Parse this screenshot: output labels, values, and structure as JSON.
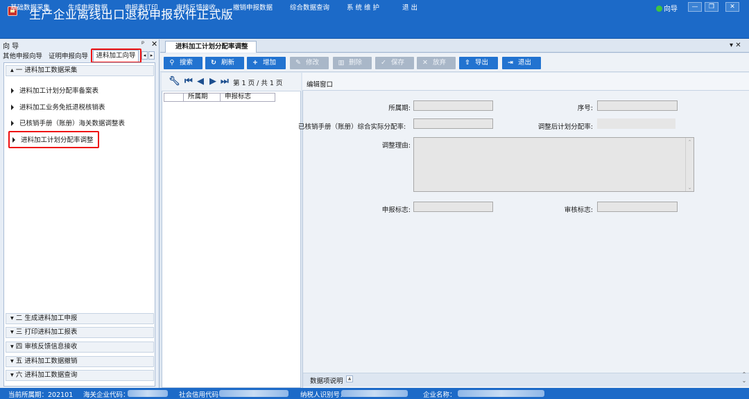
{
  "window": {
    "title": "生产企业离线出口退税申报软件正式版",
    "wizard": "向导"
  },
  "menu": [
    "基础数据采集",
    "生成申报数据",
    "申报表打印",
    "审核反馈接收",
    "撤销申报数据",
    "综合数据查询",
    "系 统 维 护",
    "退 出"
  ],
  "left_panel": {
    "title": "向 导",
    "tabs": [
      "其他申报向导",
      "证明申报向导",
      "进料加工向导"
    ],
    "groups": [
      {
        "label": "一 进料加工数据采集",
        "items": [
          "进料加工计划分配率备案表",
          "进料加工业务免抵退税核销表",
          "已核销手册（账册）海关数据调整表",
          "进料加工计划分配率调整"
        ]
      },
      {
        "label": "二 生成进料加工申报"
      },
      {
        "label": "三 打印进料加工报表"
      },
      {
        "label": "四 审核反馈信息接收"
      },
      {
        "label": "五 进料加工数据撤销"
      },
      {
        "label": "六 进料加工数据查询"
      }
    ]
  },
  "doc_tab": "进料加工计划分配率调整",
  "toolbar": {
    "search": "搜索",
    "refresh": "刷新",
    "add": "增加",
    "edit": "修改",
    "delete": "删除",
    "save": "保存",
    "discard": "放弃",
    "export": "导出",
    "exit": "退出"
  },
  "grid": {
    "pager": "第 1 页 / 共 1 页",
    "columns": [
      "所属期",
      "申报标志"
    ]
  },
  "edit": {
    "title": "编辑窗口",
    "period": "所属期:",
    "seq": "序号:",
    "ratio": "已核销手册（账册）综合实际分配率:",
    "adjusted": "调整后计划分配率:",
    "reason": "调整理由:",
    "declare_flag": "申报标志:",
    "audit_flag": "审核标志:"
  },
  "data_desc": "数据项说明",
  "status": {
    "period": "当前所属期：202101",
    "customs": "海关企业代码：",
    "credit": "社会信用代码",
    "taxpayer": "纳税人识别号：",
    "company": "企业名称："
  }
}
